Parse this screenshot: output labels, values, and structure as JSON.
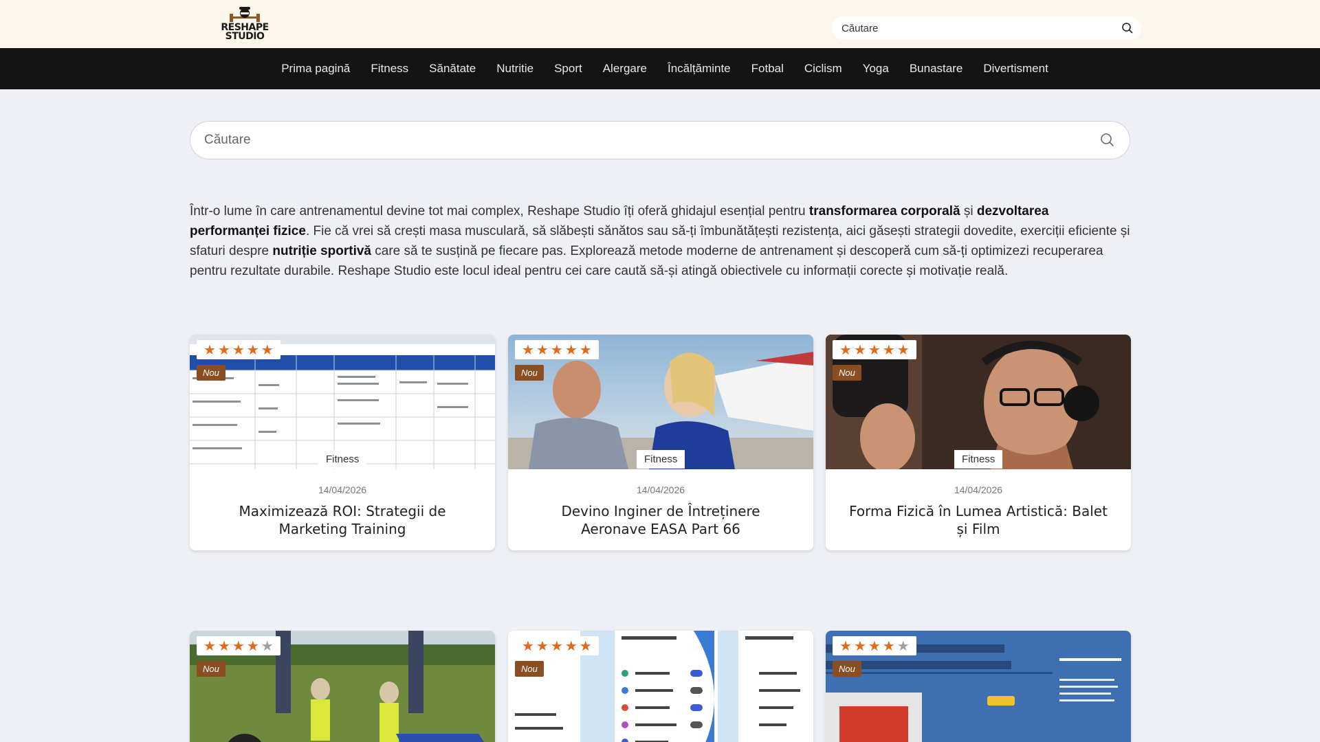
{
  "header": {
    "logo_line1": "RESHAPE",
    "logo_line2": "STUDIO",
    "search_placeholder": "Căutare"
  },
  "nav": {
    "items": [
      {
        "label": "Prima pagină"
      },
      {
        "label": "Fitness"
      },
      {
        "label": "Sănătate"
      },
      {
        "label": "Nutritie"
      },
      {
        "label": "Sport"
      },
      {
        "label": "Alergare"
      },
      {
        "label": "Încălțăminte"
      },
      {
        "label": "Fotbal"
      },
      {
        "label": "Ciclism"
      },
      {
        "label": "Yoga"
      },
      {
        "label": "Bunastare"
      },
      {
        "label": "Divertisment"
      }
    ]
  },
  "main_search": {
    "placeholder": "Căutare"
  },
  "intro": {
    "p1": "Într-o lume în care antrenamentul devine tot mai complex, Reshape Studio îți oferă ghidajul esențial pentru ",
    "b1": "transformarea corporală",
    "p2": " și ",
    "b2": "dezvoltarea performanței fizice",
    "p3": ". Fie că vrei să crești masa musculară, să slăbești sănătos sau să-ți îmbunătățești rezistența, aici găsești strategii dovedite, exerciții eficiente și sfaturi despre ",
    "b3": "nutriție sportivă",
    "p4": " care să te susțină pe fiecare pas. Explorează metode moderne de antrenament și descoperă cum să-ți optimizezi recuperarea pentru rezultate durabile. Reshape Studio este locul ideal pentru cei care caută să-și atingă obiectivele cu informații corecte și motivație reală."
  },
  "cards": [
    {
      "rating": 5,
      "badge": "Nou",
      "category": "Fitness",
      "date": "14/04/2026",
      "title": "Maximizează ROI: Strategii de Marketing Training",
      "image": "training-schedule-table"
    },
    {
      "rating": 5,
      "badge": "Nou",
      "category": "Fitness",
      "date": "14/04/2026",
      "title": "Devino Inginer de Întreținere Aeronave EASA Part 66",
      "image": "aircraft-engineers"
    },
    {
      "rating": 5,
      "badge": "Nou",
      "category": "Fitness",
      "date": "14/04/2026",
      "title": "Forma Fizică în Lumea Artistică: Balet și Film",
      "image": "singer-microphone"
    },
    {
      "rating": 4,
      "badge": "Nou",
      "image": "motorcycle-training"
    },
    {
      "rating": 5,
      "badge": "Nou",
      "image": "connected-apps-screens"
    },
    {
      "rating": 4,
      "badge": "Nou",
      "image": "records-management-course"
    }
  ],
  "colors": {
    "topbar_bg": "#fdf6ea",
    "navbar_bg": "#141414",
    "page_bg": "#eef0f5",
    "star_on": "#e06a1a",
    "star_off": "#9aa0a8",
    "badge_bg": "#8b4e22"
  }
}
